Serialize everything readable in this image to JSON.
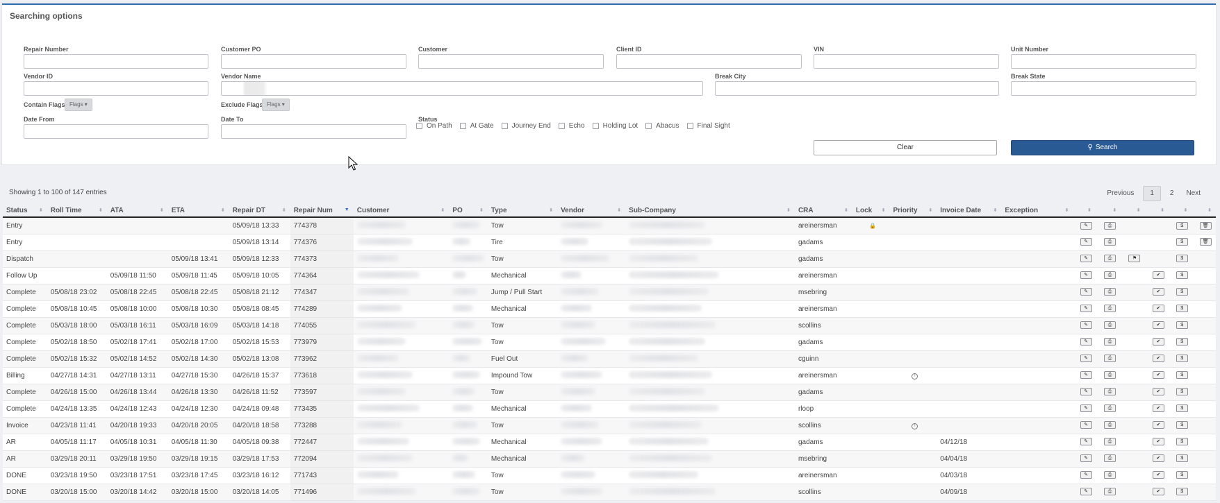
{
  "search_panel": {
    "title": "Searching options",
    "fields": {
      "repair_number": {
        "label": "Repair Number",
        "value": ""
      },
      "customer_po": {
        "label": "Customer PO",
        "value": ""
      },
      "customer": {
        "label": "Customer",
        "value": ""
      },
      "client_id": {
        "label": "Client ID",
        "value": ""
      },
      "vin": {
        "label": "VIN",
        "value": ""
      },
      "unit_number": {
        "label": "Unit Number",
        "value": ""
      },
      "vendor_id": {
        "label": "Vendor ID",
        "value": ""
      },
      "vendor_name": {
        "label": "Vendor Name",
        "value": ""
      },
      "break_city": {
        "label": "Break City",
        "value": ""
      },
      "break_state": {
        "label": "Break State",
        "value": ""
      },
      "date_from": {
        "label": "Date From",
        "value": ""
      },
      "date_to": {
        "label": "Date To",
        "value": ""
      }
    },
    "contain_flags_label": "Contain Flags*",
    "exclude_flags_label": "Exclude Flags*",
    "flags_button": "Flags",
    "status_label": "Status",
    "status_options": [
      "On Path",
      "At Gate",
      "Journey End",
      "Echo",
      "Holding Lot",
      "Abacus",
      "Final Sight"
    ],
    "clear_button": "Clear",
    "search_button": "Search"
  },
  "table_info": "Showing 1 to 100 of 147 entries",
  "pagination": {
    "previous": "Previous",
    "pages": [
      "1",
      "2"
    ],
    "current": "1",
    "next": "Next"
  },
  "columns": [
    "Status",
    "Roll Time",
    "ATA",
    "ETA",
    "Repair DT",
    "Repair Num",
    "Customer",
    "PO",
    "Type",
    "Vendor",
    "Sub-Company",
    "CRA",
    "Lock",
    "Priority",
    "Invoice Date",
    "Exception"
  ],
  "rows": [
    {
      "status": "Entry",
      "roll": "",
      "ata": "",
      "eta": "",
      "repair_dt": "05/09/18 13:33",
      "num": "774378",
      "type": "Tow",
      "cra": "areinersman",
      "lock": true,
      "priority": false,
      "invoice": "",
      "flag": false,
      "check": false,
      "trash": true
    },
    {
      "status": "Entry",
      "roll": "",
      "ata": "",
      "eta": "",
      "repair_dt": "05/09/18 13:14",
      "num": "774376",
      "type": "Tire",
      "cra": "gadams",
      "lock": false,
      "priority": false,
      "invoice": "",
      "flag": false,
      "check": false,
      "trash": true
    },
    {
      "status": "Dispatch",
      "roll": "",
      "ata": "",
      "eta": "05/09/18 13:41",
      "repair_dt": "05/09/18 12:33",
      "num": "774373",
      "type": "Tow",
      "cra": "gadams",
      "lock": false,
      "priority": false,
      "invoice": "",
      "flag": true,
      "check": false,
      "trash": false
    },
    {
      "status": "Follow Up",
      "roll": "",
      "ata": "05/09/18 11:50",
      "eta": "05/09/18 11:45",
      "repair_dt": "05/09/18 10:05",
      "num": "774364",
      "type": "Mechanical",
      "cra": "areinersman",
      "lock": false,
      "priority": false,
      "invoice": "",
      "flag": false,
      "check": true,
      "trash": false
    },
    {
      "status": "Complete",
      "roll": "05/08/18 23:02",
      "ata": "05/08/18 22:45",
      "eta": "05/08/18 22:45",
      "repair_dt": "05/08/18 21:12",
      "num": "774347",
      "type": "Jump / Pull Start",
      "cra": "msebring",
      "lock": false,
      "priority": false,
      "invoice": "",
      "flag": false,
      "check": true,
      "trash": false
    },
    {
      "status": "Complete",
      "roll": "05/08/18 10:45",
      "ata": "05/08/18 10:00",
      "eta": "05/08/18 10:30",
      "repair_dt": "05/08/18 08:45",
      "num": "774289",
      "type": "Mechanical",
      "cra": "areinersman",
      "lock": false,
      "priority": false,
      "invoice": "",
      "flag": false,
      "check": true,
      "trash": false
    },
    {
      "status": "Complete",
      "roll": "05/03/18 18:00",
      "ata": "05/03/18 16:11",
      "eta": "05/03/18 16:09",
      "repair_dt": "05/03/18 14:18",
      "num": "774055",
      "type": "Tow",
      "cra": "scollins",
      "lock": false,
      "priority": false,
      "invoice": "",
      "flag": false,
      "check": true,
      "trash": false
    },
    {
      "status": "Complete",
      "roll": "05/02/18 18:50",
      "ata": "05/02/18 17:41",
      "eta": "05/02/18 17:00",
      "repair_dt": "05/02/18 15:53",
      "num": "773979",
      "type": "Tow",
      "cra": "gadams",
      "lock": false,
      "priority": false,
      "invoice": "",
      "flag": false,
      "check": true,
      "trash": false
    },
    {
      "status": "Complete",
      "roll": "05/02/18 15:32",
      "ata": "05/02/18 14:52",
      "eta": "05/02/18 14:30",
      "repair_dt": "05/02/18 13:08",
      "num": "773962",
      "type": "Fuel Out",
      "cra": "cguinn",
      "lock": false,
      "priority": false,
      "invoice": "",
      "flag": false,
      "check": true,
      "trash": false
    },
    {
      "status": "Billing",
      "roll": "04/27/18 14:31",
      "ata": "04/27/18 13:11",
      "eta": "04/27/18 15:30",
      "repair_dt": "04/26/18 15:37",
      "num": "773618",
      "type": "Impound Tow",
      "cra": "areinersman",
      "lock": false,
      "priority": true,
      "invoice": "",
      "flag": false,
      "check": true,
      "trash": false
    },
    {
      "status": "Complete",
      "roll": "04/26/18 15:00",
      "ata": "04/26/18 13:44",
      "eta": "04/26/18 13:30",
      "repair_dt": "04/26/18 11:52",
      "num": "773597",
      "type": "Tow",
      "cra": "gadams",
      "lock": false,
      "priority": false,
      "invoice": "",
      "flag": false,
      "check": true,
      "trash": false
    },
    {
      "status": "Complete",
      "roll": "04/24/18 13:35",
      "ata": "04/24/18 12:43",
      "eta": "04/24/18 12:30",
      "repair_dt": "04/24/18 09:48",
      "num": "773435",
      "type": "Mechanical",
      "cra": "rloop",
      "lock": false,
      "priority": false,
      "invoice": "",
      "flag": false,
      "check": true,
      "trash": false
    },
    {
      "status": "Invoice",
      "roll": "04/23/18 11:41",
      "ata": "04/20/18 19:33",
      "eta": "04/20/18 20:05",
      "repair_dt": "04/20/18 18:58",
      "num": "773288",
      "type": "Tow",
      "cra": "scollins",
      "lock": false,
      "priority": true,
      "invoice": "",
      "flag": false,
      "check": true,
      "trash": false
    },
    {
      "status": "AR",
      "roll": "04/05/18 11:17",
      "ata": "04/05/18 10:31",
      "eta": "04/05/18 11:30",
      "repair_dt": "04/05/18 09:38",
      "num": "772447",
      "type": "Mechanical",
      "cra": "gadams",
      "lock": false,
      "priority": false,
      "invoice": "04/12/18",
      "flag": false,
      "check": true,
      "trash": false
    },
    {
      "status": "AR",
      "roll": "03/29/18 20:11",
      "ata": "03/29/18 19:50",
      "eta": "03/29/18 19:15",
      "repair_dt": "03/29/18 17:53",
      "num": "772094",
      "type": "Mechanical",
      "cra": "msebring",
      "lock": false,
      "priority": false,
      "invoice": "04/04/18",
      "flag": false,
      "check": true,
      "trash": false
    },
    {
      "status": "DONE",
      "roll": "03/23/18 19:50",
      "ata": "03/23/18 17:51",
      "eta": "03/23/18 17:45",
      "repair_dt": "03/23/18 16:12",
      "num": "771743",
      "type": "Tow",
      "cra": "areinersman",
      "lock": false,
      "priority": false,
      "invoice": "04/03/18",
      "flag": false,
      "check": true,
      "trash": false
    },
    {
      "status": "DONE",
      "roll": "03/20/18 15:00",
      "ata": "03/20/18 14:42",
      "eta": "03/20/18 15:00",
      "repair_dt": "03/20/18 14:05",
      "num": "771496",
      "type": "Tow",
      "cra": "scollins",
      "lock": false,
      "priority": false,
      "invoice": "04/09/18",
      "flag": false,
      "check": true,
      "trash": false
    }
  ],
  "icons": {
    "edit": "edit-icon",
    "print": "print-icon",
    "flag": "flag-icon",
    "check": "check-icon",
    "dollar": "dollar-icon",
    "trash": "trash-icon",
    "lock": "lock-icon",
    "priority": "priority-icon",
    "search": "search-icon"
  },
  "colors": {
    "accent": "#2a5a94",
    "panel_border": "#2f6db5",
    "sort_active": "#3c6ad0"
  }
}
